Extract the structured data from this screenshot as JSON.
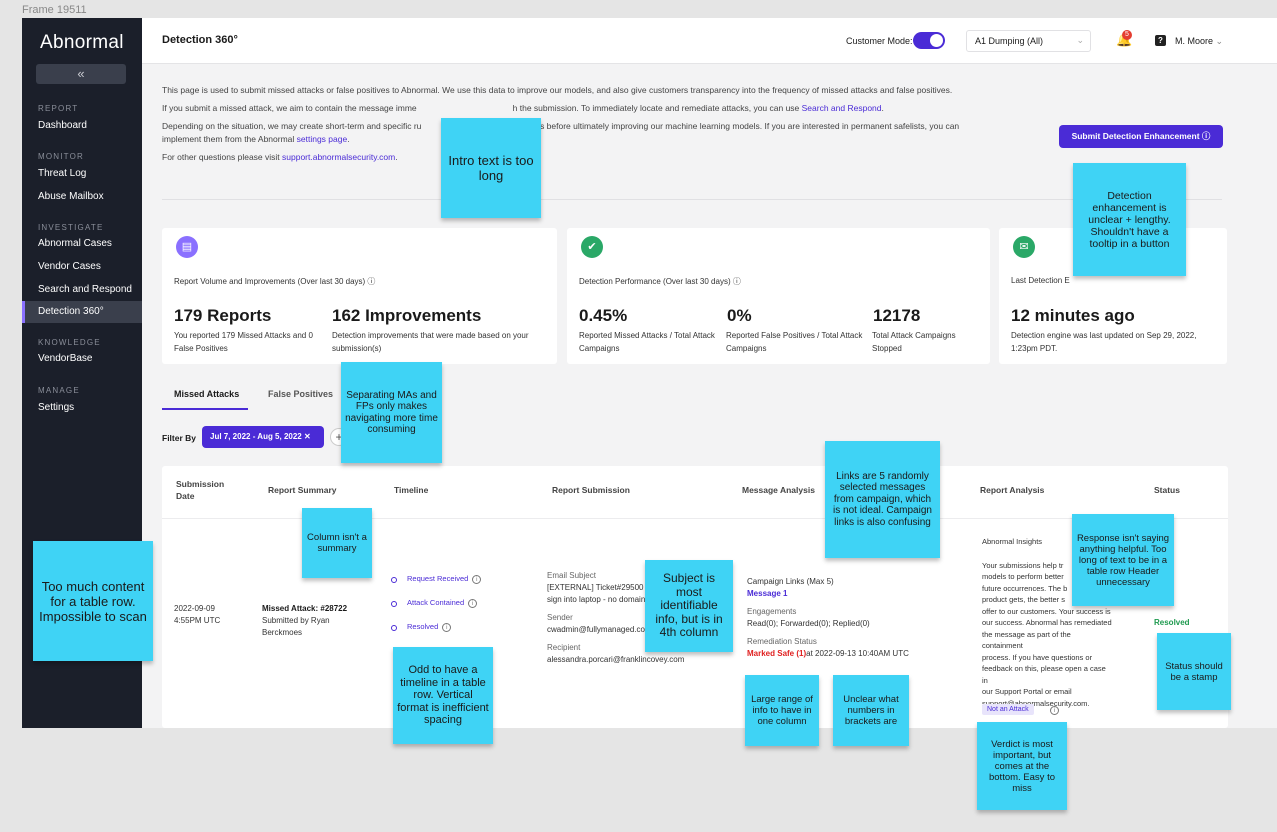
{
  "frame_label": "Frame 19511",
  "sidebar": {
    "logo": "Abnormal",
    "collapse": "«",
    "sections": [
      {
        "label": "REPORT",
        "items": [
          "Dashboard"
        ]
      },
      {
        "label": "MONITOR",
        "items": [
          "Threat Log",
          "Abuse Mailbox"
        ]
      },
      {
        "label": "INVESTIGATE",
        "items": [
          "Abnormal Cases",
          "Vendor Cases",
          "Search and Respond",
          "Detection 360°"
        ]
      },
      {
        "label": "KNOWLEDGE",
        "items": [
          "VendorBase"
        ]
      },
      {
        "label": "MANAGE",
        "items": [
          "Settings"
        ]
      }
    ],
    "active": "Detection 360°"
  },
  "header": {
    "title": "Detection 360°",
    "customer_mode_label": "Customer Mode:",
    "customer_mode_on": true,
    "tenant": "A1 Dumping (All)",
    "notification_count": "5",
    "help": "?",
    "user": "M. Moore"
  },
  "intro": {
    "p1": "This page is used to submit missed attacks or false positives to Abnormal. We use this data to improve our models, and also give customers transparency into the frequency of missed attacks and false positives.",
    "p2_a": "If you submit a missed attack, we aim to contain the message imme",
    "p2_b": "h the submission. To immediately locate and remediate attacks, you can use ",
    "p2_link": "Search and Respond",
    "p3_a": "Depending on the situation, we may create short-term and specific ru",
    "p3_b": "ssages before ultimately improving our machine learning models. If you are interested in permanent safelists, you can implement them from the Abnormal ",
    "p3_link": "settings page",
    "p4_a": "For other questions please visit ",
    "p4_link": "support.abnormalsecurity.com"
  },
  "submit_button": "Submit Detection Enhancement ⓘ",
  "cards": [
    {
      "title": "Report Volume and Improvements (Over last 30 days) ⓘ",
      "stats": [
        {
          "value": "179 Reports",
          "desc": "You reported 179 Missed Attacks and 0 False Positives"
        },
        {
          "value": "162 Improvements",
          "desc": "Detection improvements that were made based on your submission(s)"
        }
      ]
    },
    {
      "title": "Detection Performance (Over last 30 days) ⓘ",
      "stats": [
        {
          "value": "0.45%",
          "desc": "Reported Missed Attacks / Total Attack Campaigns"
        },
        {
          "value": "0%",
          "desc": "Reported False Positives / Total Attack Campaigns"
        },
        {
          "value": "12178",
          "desc": "Total Attack Campaigns Stopped"
        }
      ]
    },
    {
      "title": "Last Detection E",
      "stats": [
        {
          "value": "12 minutes ago",
          "desc": "Detection engine was last updated on Sep 29, 2022, 1:23pm PDT."
        }
      ]
    }
  ],
  "tabs": [
    "Missed Attacks",
    "False Positives"
  ],
  "filter": {
    "label": "Filter By",
    "chip": "Jul 7, 2022 - Aug 5, 2022 ✕",
    "add": "+"
  },
  "table": {
    "headers": [
      "Submission Date",
      "Report Summary",
      "Timeline",
      "Report Submission",
      "Message Analysis",
      "Report Analysis",
      "Status"
    ],
    "row": {
      "date": "2022-09-09",
      "time": "4:55PM UTC",
      "summary_title": "Missed Attack: #28722",
      "summary_by": "Submitted by Ryan Berckmoes",
      "timeline": [
        "Request Received",
        "Attack Contained",
        "Resolved"
      ],
      "email_subject_label": "Email Subject",
      "email_subject": "[EXTERNAL] Ticket#29500",
      "email_subject_2": "sign into laptop - no domain",
      "sender_label": "Sender",
      "sender": "cwadmin@fullymanaged.co",
      "recipient_label": "Recipient",
      "recipient": "alessandra.porcari@franklincovey.com",
      "campaign_label": "Campaign Links (Max 5)",
      "campaign_link": "Message 1",
      "engagements_label": "Engagements",
      "engagements": "Read(0); Forwarded(0); Replied(0)",
      "remediation_label": "Remediation Status",
      "remediation_status": "Marked Safe (1)",
      "remediation_time": "at 2022-09-13 10:40AM UTC",
      "insights_label": "Abnormal Insights",
      "insights_1": "Your submissions help tr",
      "insights_2": "models to perform better",
      "insights_3": "future occurrences. The b",
      "insights_4": "product gets, the better s",
      "insights_5": "offer to our customers. Your success is",
      "insights_6": "our success. Abnormal has remediated",
      "insights_7": "the message as part of the containment",
      "insights_8": "process. If you have questions or",
      "insights_9": "feedback on this, please open a case in",
      "insights_10": "our Support Portal or email",
      "insights_11": "support@abnormalsecurity.com.",
      "verdict": "Not an Attack",
      "status": "Resolved"
    }
  },
  "stickies": [
    "Intro text is too long",
    "Detection enhancement is unclear + lengthy. Shouldn't have a tooltip in a button",
    "Separating MAs and FPs only makes navigating more time consuming",
    "Links are 5 randomly selected messages from campaign, which is not ideal. Campaign links is also confusing",
    "Column isn't a summary",
    "Response isn't saying anything helpful. Too long of text to be in a table row Header unnecessary",
    "Too much content for a table row. Impossible to scan",
    "Subject is most identifiable info, but is in 4th column",
    "Odd to have a timeline in a table row. Vertical format is inefficient spacing",
    "Status should be a stamp",
    "Large range of info to have in one column",
    "Unclear what numbers in brackets are",
    "Verdict is most important, but comes at the bottom. Easy to miss"
  ]
}
